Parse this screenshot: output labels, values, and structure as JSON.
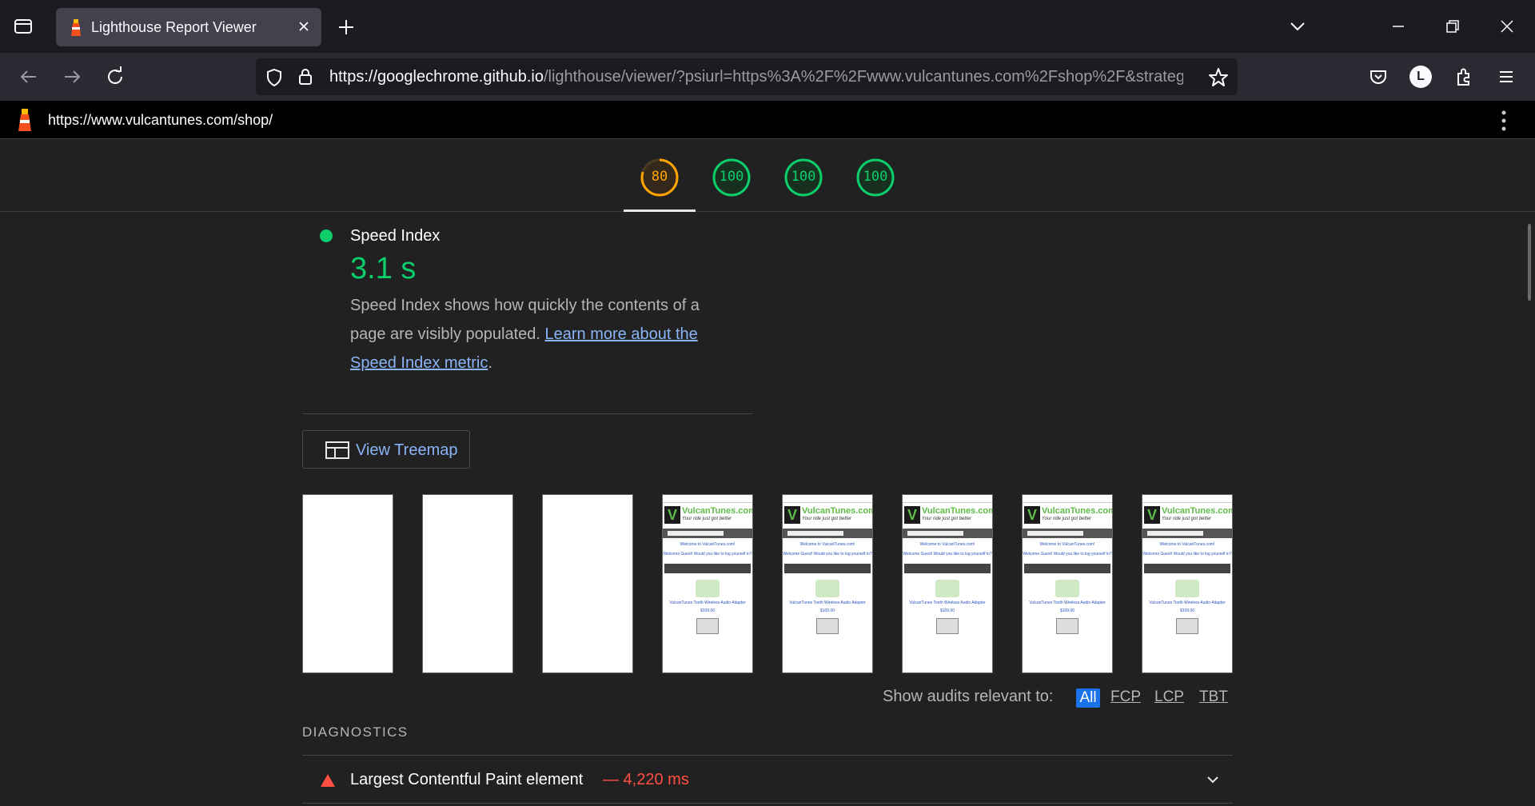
{
  "browser": {
    "tab_title": "Lighthouse Report Viewer",
    "url_host": "https://googlechrome.github.io",
    "url_path": "/lighthouse/viewer/?psiurl=https%3A%2F%2Fwww.vulcantunes.com%2Fshop%2F&strategy",
    "account_initial": "L"
  },
  "lighthouse": {
    "page_url": "https://www.vulcantunes.com/shop/",
    "gauges": [
      {
        "score": "80",
        "color": "#ffa400"
      },
      {
        "score": "100",
        "color": "#0cce6b"
      },
      {
        "score": "100",
        "color": "#0cce6b"
      },
      {
        "score": "100",
        "color": "#0cce6b"
      }
    ],
    "metric": {
      "title": "Speed Index",
      "value": "3.1 s",
      "desc_text": "Speed Index shows how quickly the contents of a page are visibly populated. ",
      "desc_link": "Learn more about the Speed Index metric",
      "desc_end": "."
    },
    "treemap_label": "View Treemap",
    "filmstrip": {
      "logo_text": "VulcanTunes.com",
      "logo_sub": "Your ride just got better",
      "welcome": "Welcome to VulcanTunes.com!",
      "guest": "Welcome Guest! Would you like to log yourself in?",
      "band": "New Products For February",
      "product": "VulcanTunes Tooth Wireless Audio Adapter",
      "price": "$109.00"
    },
    "show_audits_label": "Show audits relevant to:",
    "filters": [
      "All",
      "FCP",
      "LCP",
      "TBT"
    ],
    "diagnostics_title": "DIAGNOSTICS",
    "diagnostic_row": {
      "title": "Largest Contentful Paint element",
      "value": "— 4,220 ms"
    }
  }
}
